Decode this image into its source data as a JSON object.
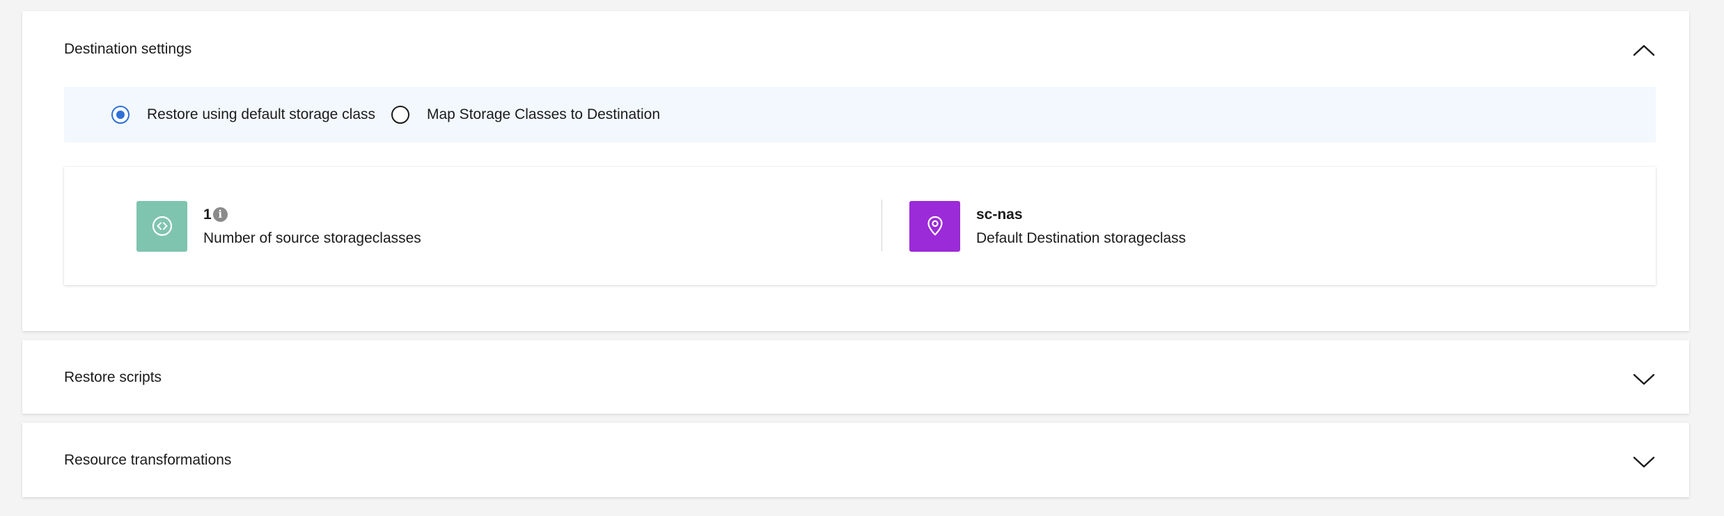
{
  "destination_settings": {
    "title": "Destination settings",
    "expanded": true,
    "radio_options": [
      {
        "label": "Restore using default storage class",
        "checked": true
      },
      {
        "label": "Map Storage Classes to Destination",
        "checked": false
      }
    ],
    "summary": {
      "source": {
        "value": "1",
        "description": "Number of source storageclasses",
        "icon": "storage-class-icon",
        "icon_color": "#7fc4af"
      },
      "destination": {
        "value": "sc-nas",
        "description": "Default Destination storageclass",
        "icon": "location-pin-icon",
        "icon_color": "#9b2ad8"
      }
    }
  },
  "restore_scripts": {
    "title": "Restore scripts",
    "expanded": false
  },
  "resource_transformations": {
    "title": "Resource transformations",
    "expanded": false
  },
  "colors": {
    "accent": "#2f6fd8",
    "radio_strip_bg": "#f2f8fd",
    "page_bg": "#f4f4f4"
  }
}
